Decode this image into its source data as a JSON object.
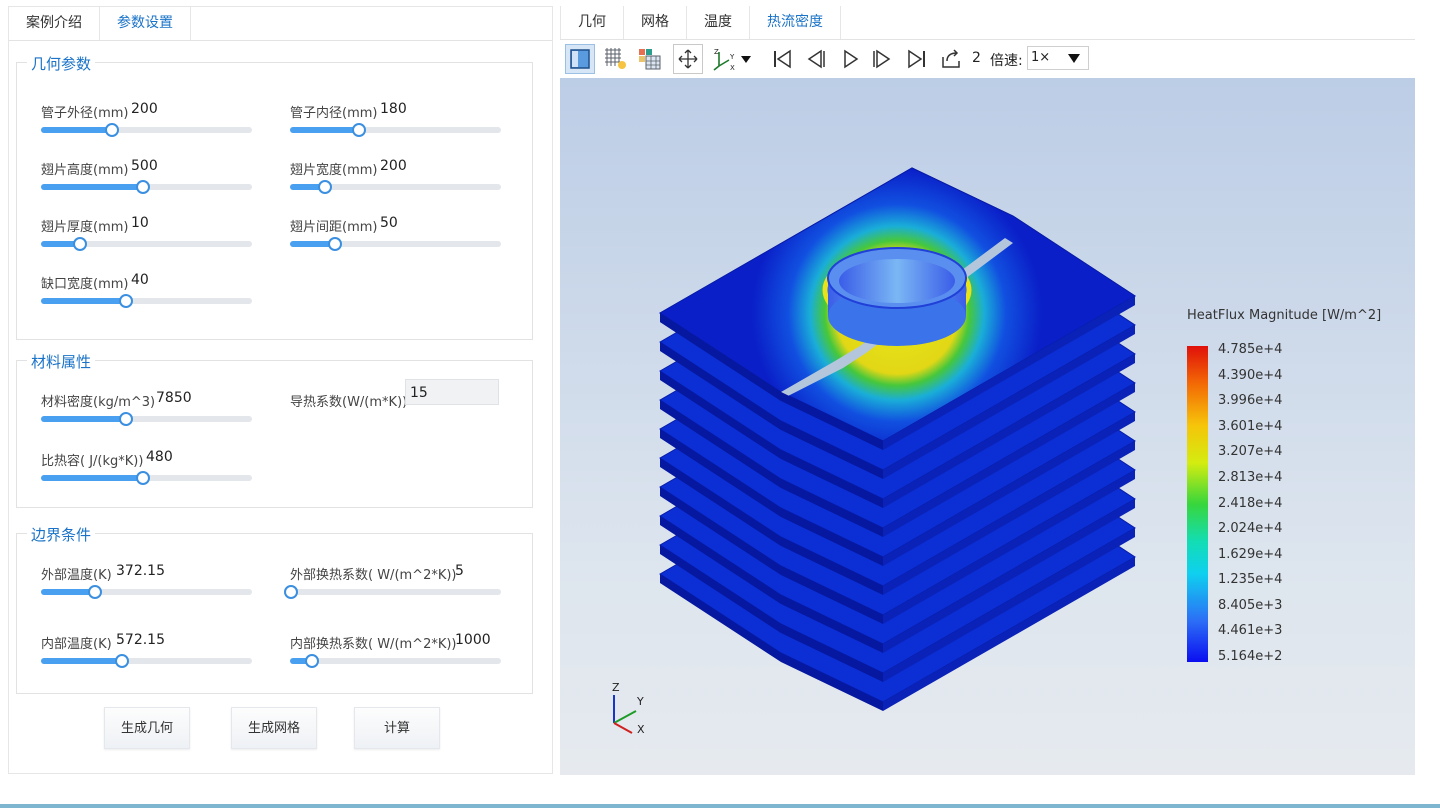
{
  "left_tabs": [
    "案例介绍",
    "参数设置"
  ],
  "active_left_tab": 1,
  "geometry": {
    "title": "几何参数",
    "params": [
      {
        "label": "管子外径(mm)",
        "value": "200",
        "fraction": 0.33
      },
      {
        "label": "管子内径(mm)",
        "value": "180",
        "fraction": 0.32
      },
      {
        "label": "翅片高度(mm)",
        "value": "500",
        "fraction": 0.48
      },
      {
        "label": "翅片宽度(mm)",
        "value": "200",
        "fraction": 0.16
      },
      {
        "label": "翅片厚度(mm)",
        "value": "10",
        "fraction": 0.18
      },
      {
        "label": "翅片间距(mm)",
        "value": "50",
        "fraction": 0.21
      },
      {
        "label": "缺口宽度(mm)",
        "value": "40",
        "fraction": 0.4
      }
    ]
  },
  "material": {
    "title": "材料属性",
    "params": [
      {
        "label": "材料密度(kg/m^3)",
        "value": "7850",
        "fraction": 0.4
      },
      {
        "label": "导热系数(W/(m*K))",
        "value": "15"
      },
      {
        "label": "比热容( J/(kg*K))",
        "value": "480",
        "fraction": 0.48
      }
    ]
  },
  "boundary": {
    "title": "边界条件",
    "params": [
      {
        "label": "外部温度(K)",
        "value": "372.15",
        "fraction": 0.25
      },
      {
        "label": "外部换热系数( W/(m^2*K))",
        "value": "5",
        "fraction": 0.0
      },
      {
        "label": "内部温度(K)",
        "value": "572.15",
        "fraction": 0.38
      },
      {
        "label": "内部换热系数( W/(m^2*K))",
        "value": "1000",
        "fraction": 0.1
      }
    ]
  },
  "buttons": {
    "gen_geometry": "生成几何",
    "gen_mesh": "生成网格",
    "compute": "计算"
  },
  "right_tabs": [
    "几何",
    "网格",
    "温度",
    "热流密度"
  ],
  "active_right_tab": 3,
  "toolbar": {
    "frame": "2",
    "speed_label": "倍速:",
    "speed_value": "1×"
  },
  "legend": {
    "title": "HeatFlux Magnitude [W/m^2]",
    "ticks": [
      "4.785e+4",
      "4.390e+4",
      "3.996e+4",
      "3.601e+4",
      "3.207e+4",
      "2.813e+4",
      "2.418e+4",
      "2.024e+4",
      "1.629e+4",
      "1.235e+4",
      "8.405e+3",
      "4.461e+3",
      "5.164e+2"
    ]
  },
  "axes": {
    "z": "Z",
    "y": "Y",
    "x": "X"
  },
  "colors": {
    "accent": "#1a73c8",
    "slider": "#4aa0f0"
  }
}
